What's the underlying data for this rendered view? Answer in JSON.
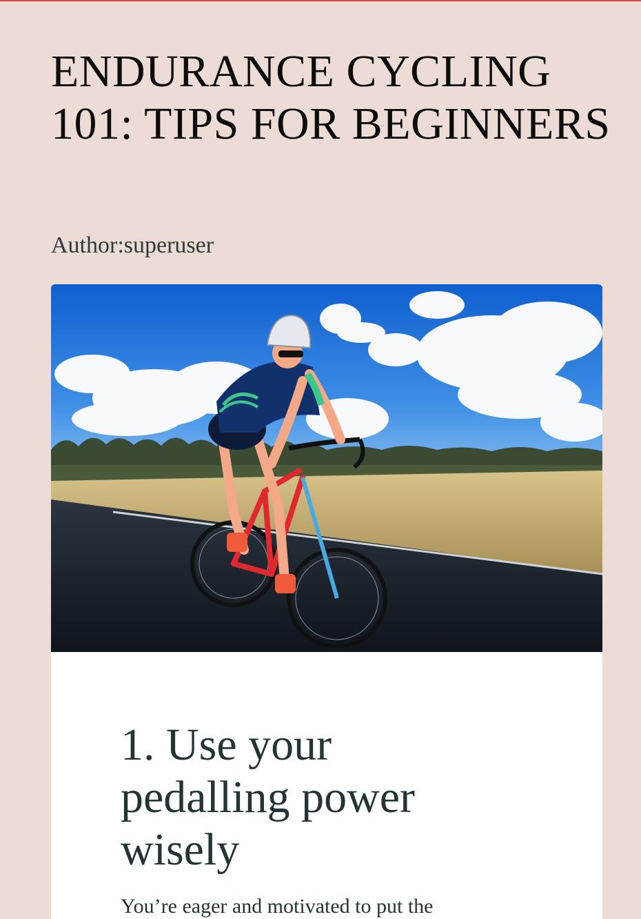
{
  "page": {
    "title_line1": "ENDURANCE CYCLING",
    "title_line2": "101: TIPS FOR BEGINNERS",
    "author": "Author:superuser"
  },
  "article": {
    "section_heading_line1": "1. Use your",
    "section_heading_line2": "pedalling power",
    "section_heading_line3": "wisely",
    "section_text": "You’re eager and motivated to put the"
  },
  "colors": {
    "background": "#ecdcd5",
    "top_accent": "#d8434b",
    "title_text": "#0c0c0c",
    "body_text": "#243434",
    "card": "#ffffff"
  }
}
